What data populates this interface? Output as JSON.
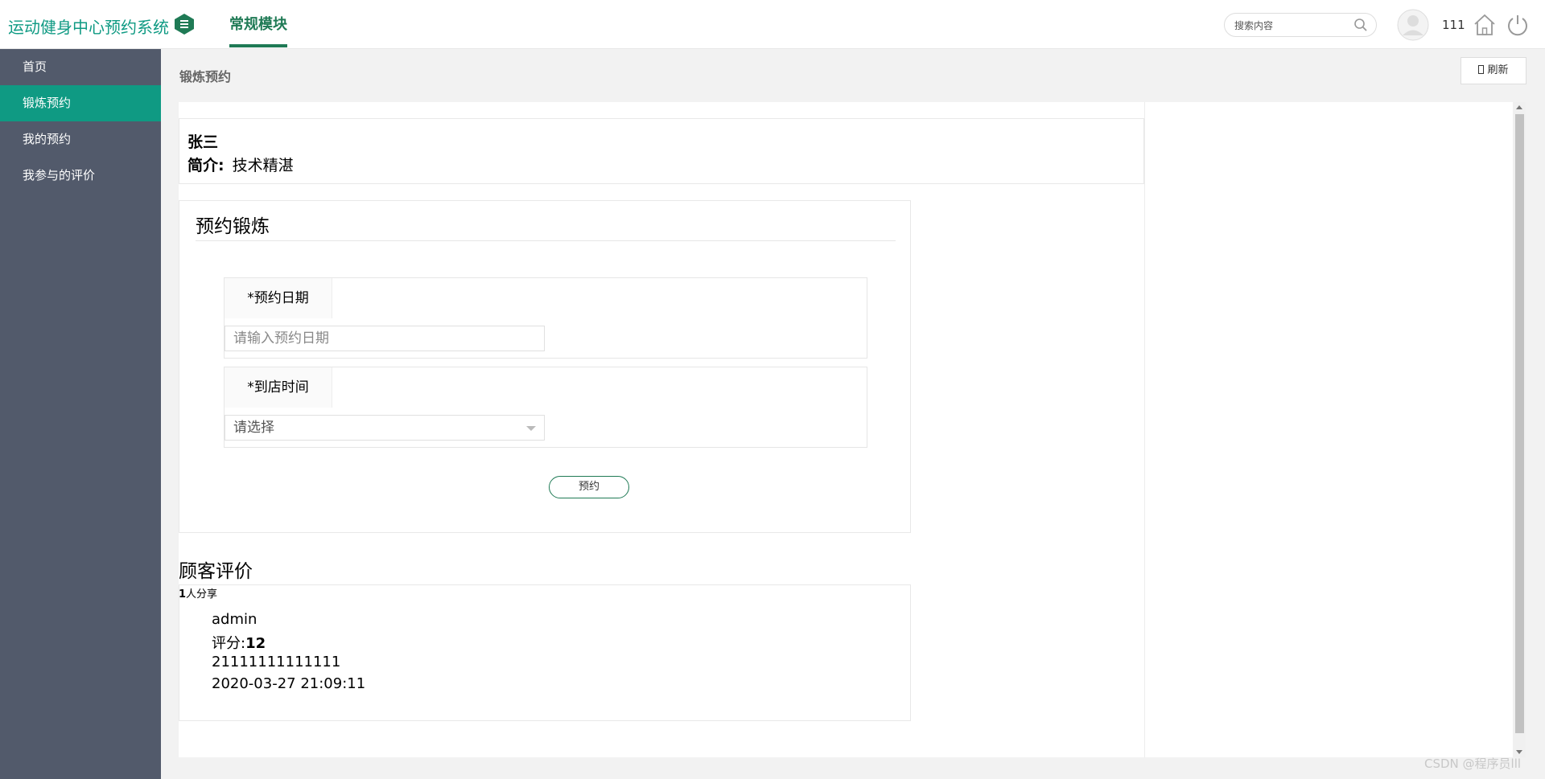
{
  "header": {
    "app_title": "运动健身中心预约系统",
    "tab_label": "常规模块",
    "search_placeholder": "搜索内容",
    "username": "111"
  },
  "sidebar": {
    "items": [
      {
        "label": "首页",
        "active": false
      },
      {
        "label": "锻炼预约",
        "active": true
      },
      {
        "label": "我的预约",
        "active": false
      },
      {
        "label": "我参与的评价",
        "active": false
      }
    ]
  },
  "page": {
    "title": "锻炼预约",
    "refresh_label": "刷新"
  },
  "coach": {
    "name": "张三",
    "intro_label": "简介:",
    "intro_value": "技术精湛"
  },
  "booking": {
    "title": "预约锻炼",
    "date_label": "*预约日期",
    "date_placeholder": "请输入预约日期",
    "time_label": "*到店时间",
    "time_placeholder": "请选择",
    "submit_label": "预约"
  },
  "reviews": {
    "title": "顾客评价",
    "share_count": "1",
    "share_suffix": "人分享",
    "items": [
      {
        "user": "admin",
        "score_label": "评分:",
        "score": "12",
        "content": "21111111111111",
        "time": "2020-03-27 21:09:11"
      }
    ]
  },
  "watermark": "CSDN @程序员lll",
  "colors": {
    "brand": "#0f9a83",
    "sidebar_bg": "#525a6b",
    "tab_accent": "#1f7a55"
  }
}
